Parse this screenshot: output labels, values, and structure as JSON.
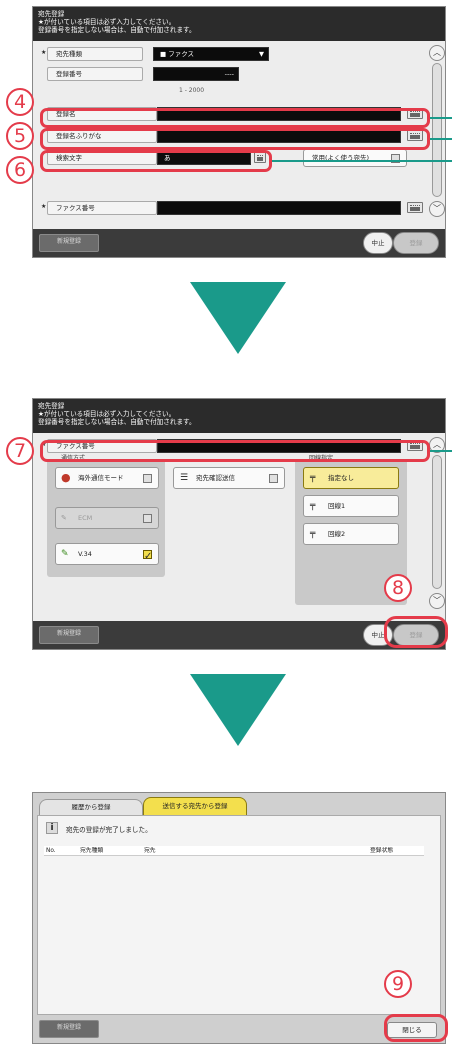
{
  "step1": {
    "title": "宛先登録",
    "notice_line1": "★が付いている項目は必ず入力してください。",
    "notice_line2": "登録番号を指定しない場合は、自動で付加されます。",
    "dest_type_label": "宛先種類",
    "dest_type_value": "ファクス",
    "reg_number_label": "登録番号",
    "reg_number_value": "----",
    "reg_range": "1 - 2000",
    "name_label": "登録名",
    "furigana_label": "登録名ふりがな",
    "search_label": "検索文字",
    "search_value": "あ",
    "frequent_label": "常用(よく使う宛先)",
    "fax_label": "ファクス番号",
    "new_reg_button": "新規登録",
    "stop_button": "中止",
    "register_button": "登録",
    "badges": [
      "4",
      "5",
      "6"
    ]
  },
  "step2": {
    "title": "宛先登録",
    "notice_line1": "★が付いている項目は必ず入力してください。",
    "notice_line2": "登録番号を指定しない場合は、自動で付加されます。",
    "fax_label": "ファクス番号",
    "comm_method_label": "通信方式",
    "overseas_label": "海外通信モード",
    "ecm_label": "ECM",
    "v34_label": "V.34",
    "confirm_label": "宛先確認送信",
    "line_spec_label": "回線指定",
    "line_none": "指定なし",
    "line1": "回線1",
    "line2": "回線2",
    "new_reg_button": "新規登録",
    "stop_button": "中止",
    "register_button": "登録",
    "badges": [
      "7",
      "8"
    ]
  },
  "step3": {
    "tab_history": "履歴から登録",
    "tab_send": "送信する宛先から登録",
    "info_icon": "i",
    "message": "宛先の登録が完了しました。",
    "col_no": "No.",
    "col_type": "宛先種類",
    "col_dest": "宛先",
    "col_status": "登録状態",
    "new_reg_button": "新規登録",
    "close_button": "閉じる",
    "badges": [
      "9"
    ]
  },
  "colors": {
    "accent_red": "#e43b4a",
    "teal": "#1a9a8a",
    "yellow": "#f3df4d"
  }
}
